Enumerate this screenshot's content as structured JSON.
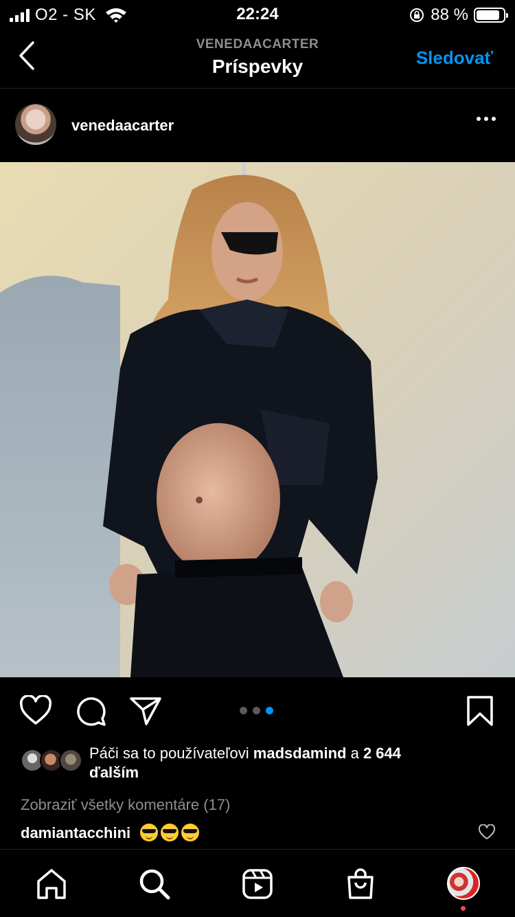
{
  "status_bar": {
    "carrier": "O2 - SK",
    "time": "22:24",
    "battery_percent": "88 %",
    "battery_level": 0.88
  },
  "nav": {
    "subtitle": "VENEDAACARTER",
    "title": "Príspevky",
    "follow_label": "Sledovať"
  },
  "post": {
    "username": "venedaacarter",
    "carousel": {
      "count": 3,
      "active_index": 2
    },
    "likes": {
      "prefix": "Páči sa to používateľovi ",
      "liker": "madsdamind",
      "middle": " a ",
      "count": "2 644",
      "suffix": "ďalším"
    },
    "view_comments": "Zobraziť všetky komentáre (17)",
    "top_comment": {
      "author": "damiantacchini",
      "emoji": [
        "😎",
        "😎",
        "😎"
      ]
    }
  },
  "colors": {
    "accent": "#0095f6",
    "background": "#000000",
    "muted": "#8e8e8e",
    "notification": "#ed4956"
  },
  "icons": {
    "action_bar": [
      "heart-icon",
      "comment-icon",
      "share-icon",
      "bookmark-icon"
    ],
    "tab_bar": [
      "home-icon",
      "search-icon",
      "reels-icon",
      "shop-icon",
      "profile-avatar"
    ]
  }
}
